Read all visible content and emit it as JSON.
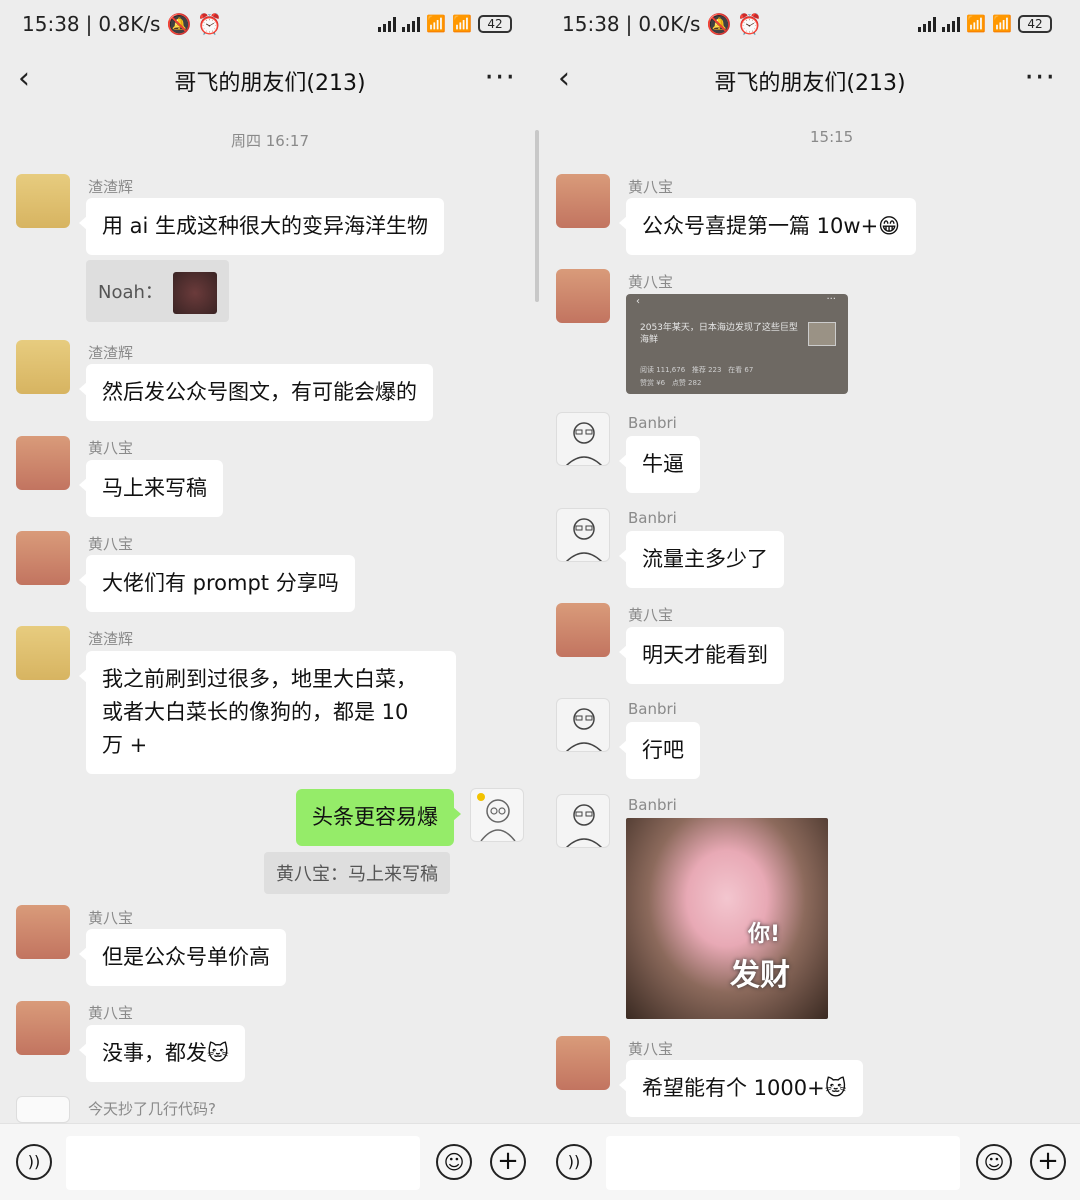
{
  "left": {
    "status": {
      "time": "15:38",
      "speed": "0.8K/s",
      "battery": "42"
    },
    "title": "哥飞的朋友们(213)",
    "timestamp": "周四 16:17",
    "messages": [
      {
        "sender": "渣渣辉",
        "text": "用 ai 生成这种很大的变异海洋生物"
      },
      {
        "quote_label": "Noah："
      },
      {
        "sender": "渣渣辉",
        "text": "然后发公众号图文，有可能会爆的"
      },
      {
        "sender": "黄八宝",
        "text": "马上来写稿"
      },
      {
        "sender": "黄八宝",
        "text": "大佬们有 prompt 分享吗"
      },
      {
        "sender": "渣渣辉",
        "lines": [
          "我之前刷到过很多，地里大白菜，",
          "或者大白菜长的像狗的，都是 10",
          "万 +"
        ]
      },
      {
        "self_text": "头条更容易爆"
      },
      {
        "quote_text": "黄八宝：马上来写稿"
      },
      {
        "sender": "黄八宝",
        "text": "但是公众号单价高"
      },
      {
        "sender": "黄八宝",
        "text": "没事，都发🐱"
      },
      {
        "sender": "今天抄了几行代码?"
      }
    ]
  },
  "right": {
    "status": {
      "time": "15:38",
      "speed": "0.0K/s",
      "battery": "42"
    },
    "title": "哥飞的朋友们(213)",
    "timestamp": "15:15",
    "messages": [
      {
        "sender": "黄八宝",
        "text": "公众号喜提第一篇 10w+😁"
      },
      {
        "sender": "黄八宝",
        "article_title": "2053年某天，日本海边发现了这些巨型海鲜",
        "article_stats": [
          "阅读 111,676",
          "推荐 223",
          "在看 67",
          "赞赏 ¥6",
          "点赞 282"
        ]
      },
      {
        "sender": "Banbri",
        "text": "牛逼"
      },
      {
        "sender": "Banbri",
        "text": "流量主多少了"
      },
      {
        "sender": "黄八宝",
        "text": "明天才能看到"
      },
      {
        "sender": "Banbri",
        "text": "行吧"
      },
      {
        "sender": "Banbri",
        "sticker_small": "你!",
        "sticker_big": "发财"
      },
      {
        "sender": "黄八宝",
        "text": "希望能有个 1000+🐱"
      }
    ]
  },
  "icons": {
    "back": "back-chevron-icon",
    "more": "more-dots-icon",
    "voice": "voice-icon",
    "emoji": "emoji-icon",
    "plus": "plus-icon"
  }
}
